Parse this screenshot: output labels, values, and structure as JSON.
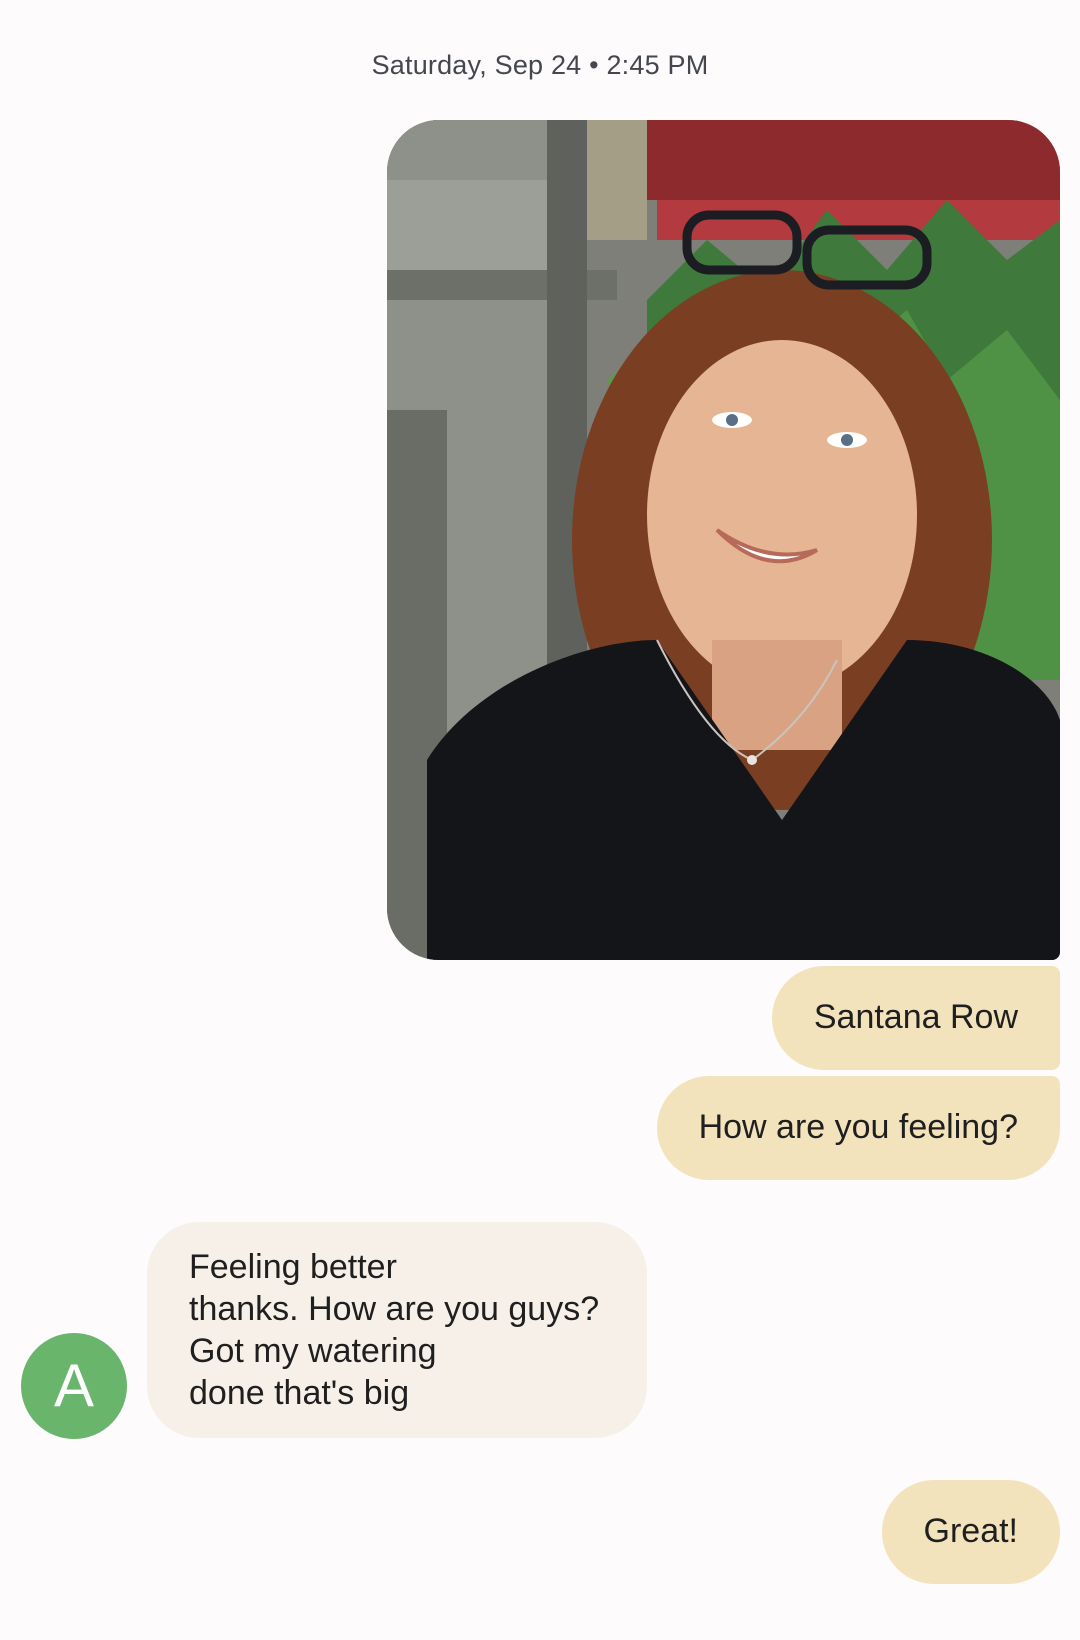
{
  "conversation": {
    "timestamp": "Saturday, Sep 24 • 2:45 PM",
    "photo": {
      "kind": "image",
      "description_icon": "photo-icon"
    },
    "messages": [
      {
        "direction": "outgoing",
        "text": "Santana Row"
      },
      {
        "direction": "outgoing",
        "text": "How are you feeling?"
      },
      {
        "direction": "incoming",
        "sender_initial": "A",
        "lines": [
          "Feeling better",
          "thanks. How are you guys?",
          "Got my watering",
          "done that's big"
        ]
      },
      {
        "direction": "outgoing",
        "text": "Great!"
      }
    ]
  },
  "colors": {
    "outgoing_bubble": "#f3e3bd",
    "incoming_bubble": "#f6f0e8",
    "avatar": "#69b56b",
    "background": "#fefbfd"
  }
}
